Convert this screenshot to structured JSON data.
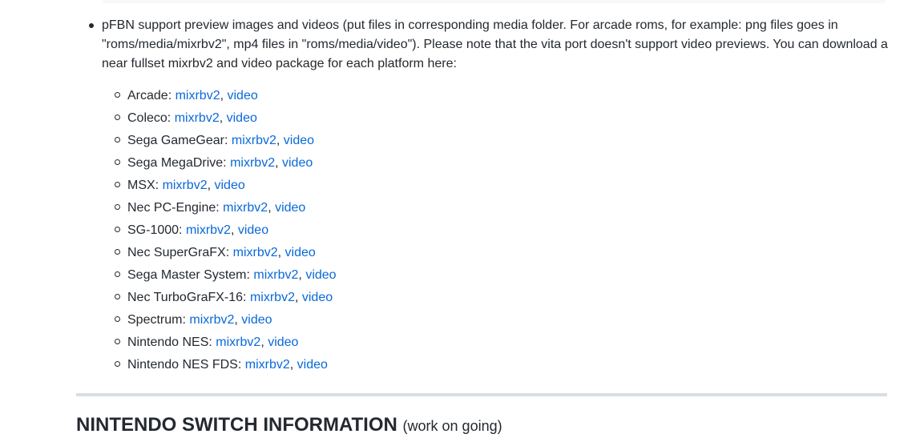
{
  "intro": {
    "text": "pFBN support preview images and videos (put files in corresponding media folder. For arcade roms, for example: png files goes in \"roms/media/mixrbv2\", mp4 files in \"roms/media/video\"). Please note that the vita port doesn't support video previews. You can download a near fullset mixrbv2 and video package for each platform here:"
  },
  "platforms": [
    {
      "name": "Arcade:",
      "image_link": "mixrbv2",
      "video_link": "video"
    },
    {
      "name": "Coleco:",
      "image_link": "mixrbv2",
      "video_link": "video"
    },
    {
      "name": "Sega GameGear:",
      "image_link": "mixrbv2",
      "video_link": "video"
    },
    {
      "name": "Sega MegaDrive:",
      "image_link": "mixrbv2",
      "video_link": "video"
    },
    {
      "name": "MSX:",
      "image_link": "mixrbv2",
      "video_link": "video"
    },
    {
      "name": "Nec PC-Engine:",
      "image_link": "mixrbv2",
      "video_link": "video"
    },
    {
      "name": "SG-1000:",
      "image_link": "mixrbv2",
      "video_link": "video"
    },
    {
      "name": "Nec SuperGraFX:",
      "image_link": "mixrbv2",
      "video_link": "video"
    },
    {
      "name": "Sega Master System:",
      "image_link": "mixrbv2",
      "video_link": "video"
    },
    {
      "name": "Nec TurboGraFX-16:",
      "image_link": "mixrbv2",
      "video_link": "video"
    },
    {
      "name": "Spectrum:",
      "image_link": "mixrbv2",
      "video_link": "video"
    },
    {
      "name": "Nintendo NES:",
      "image_link": "mixrbv2",
      "video_link": "video"
    },
    {
      "name": "Nintendo NES FDS:",
      "image_link": "mixrbv2",
      "video_link": "video"
    }
  ],
  "separator": ", ",
  "next_section": {
    "title": "NINTENDO SWITCH INFORMATION",
    "subtitle": "(work on going)"
  },
  "colors": {
    "text": "#24292f",
    "link": "#0969da",
    "divider": "#d8dee4"
  }
}
